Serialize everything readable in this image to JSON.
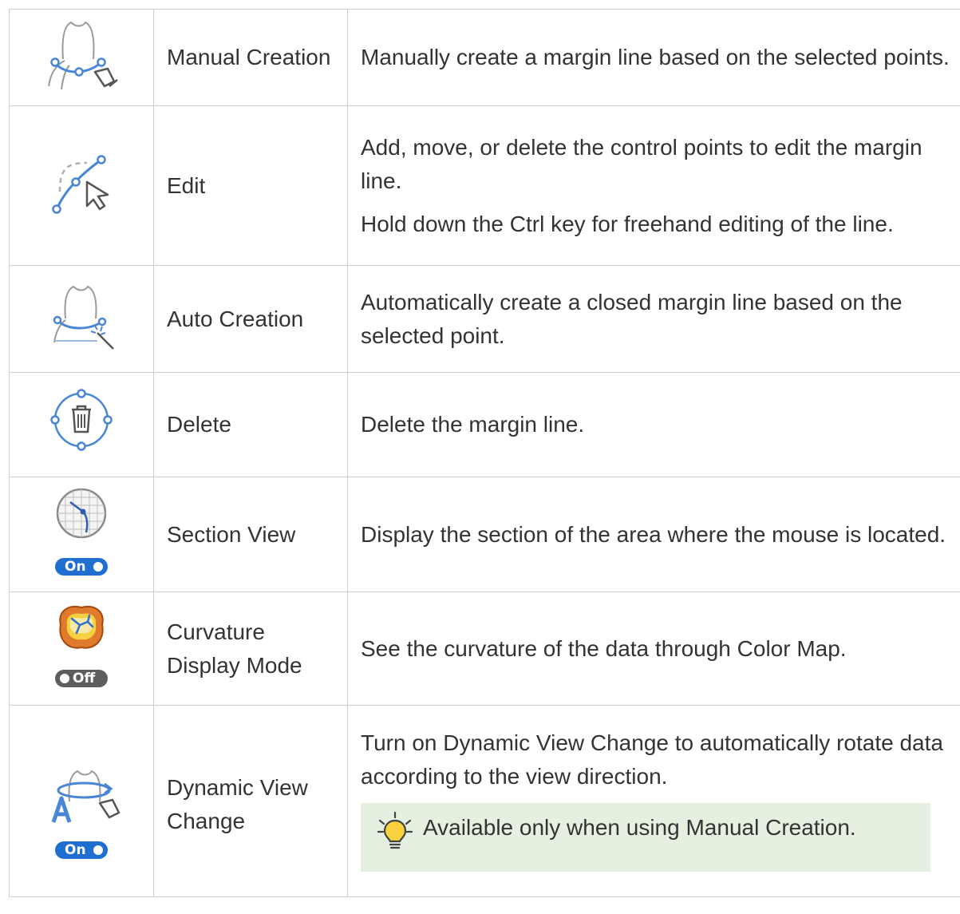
{
  "rows": [
    {
      "icon": "manual-creation-icon",
      "name": "Manual Creation",
      "desc": [
        "Manually create a margin line based on the selected points."
      ]
    },
    {
      "icon": "edit-icon",
      "name": "Edit",
      "desc": [
        "Add, move, or delete the control points to edit the margin line.",
        "Hold down the Ctrl key for freehand editing of the line."
      ]
    },
    {
      "icon": "auto-creation-icon",
      "name": "Auto Creation",
      "desc": [
        "Automatically create a closed margin line based on the selected point."
      ]
    },
    {
      "icon": "delete-icon",
      "name": "Delete",
      "desc": [
        "Delete the margin line."
      ]
    },
    {
      "icon": "section-view-icon",
      "toggle": "On",
      "name": "Section View",
      "desc": [
        "Display the section of the area where the mouse is located."
      ]
    },
    {
      "icon": "curvature-display-icon",
      "toggle": "Off",
      "name": "Curvature Display Mode",
      "desc": [
        "See the curvature of the data through Color Map."
      ]
    },
    {
      "icon": "dynamic-view-change-icon",
      "toggle": "On",
      "name": "Dynamic View Change",
      "desc": [
        "Turn on Dynamic View Change to automatically rotate data according to the view direction."
      ],
      "note": {
        "icon": "lightbulb-icon",
        "text": "Available only when using Manual Creation."
      }
    }
  ],
  "colors": {
    "accent_blue": "#4a86d6",
    "toggle_on": "#1f6fd1",
    "toggle_off": "#5d5d5d",
    "note_background": "#e6f0e0",
    "border": "#cfcfcf"
  }
}
